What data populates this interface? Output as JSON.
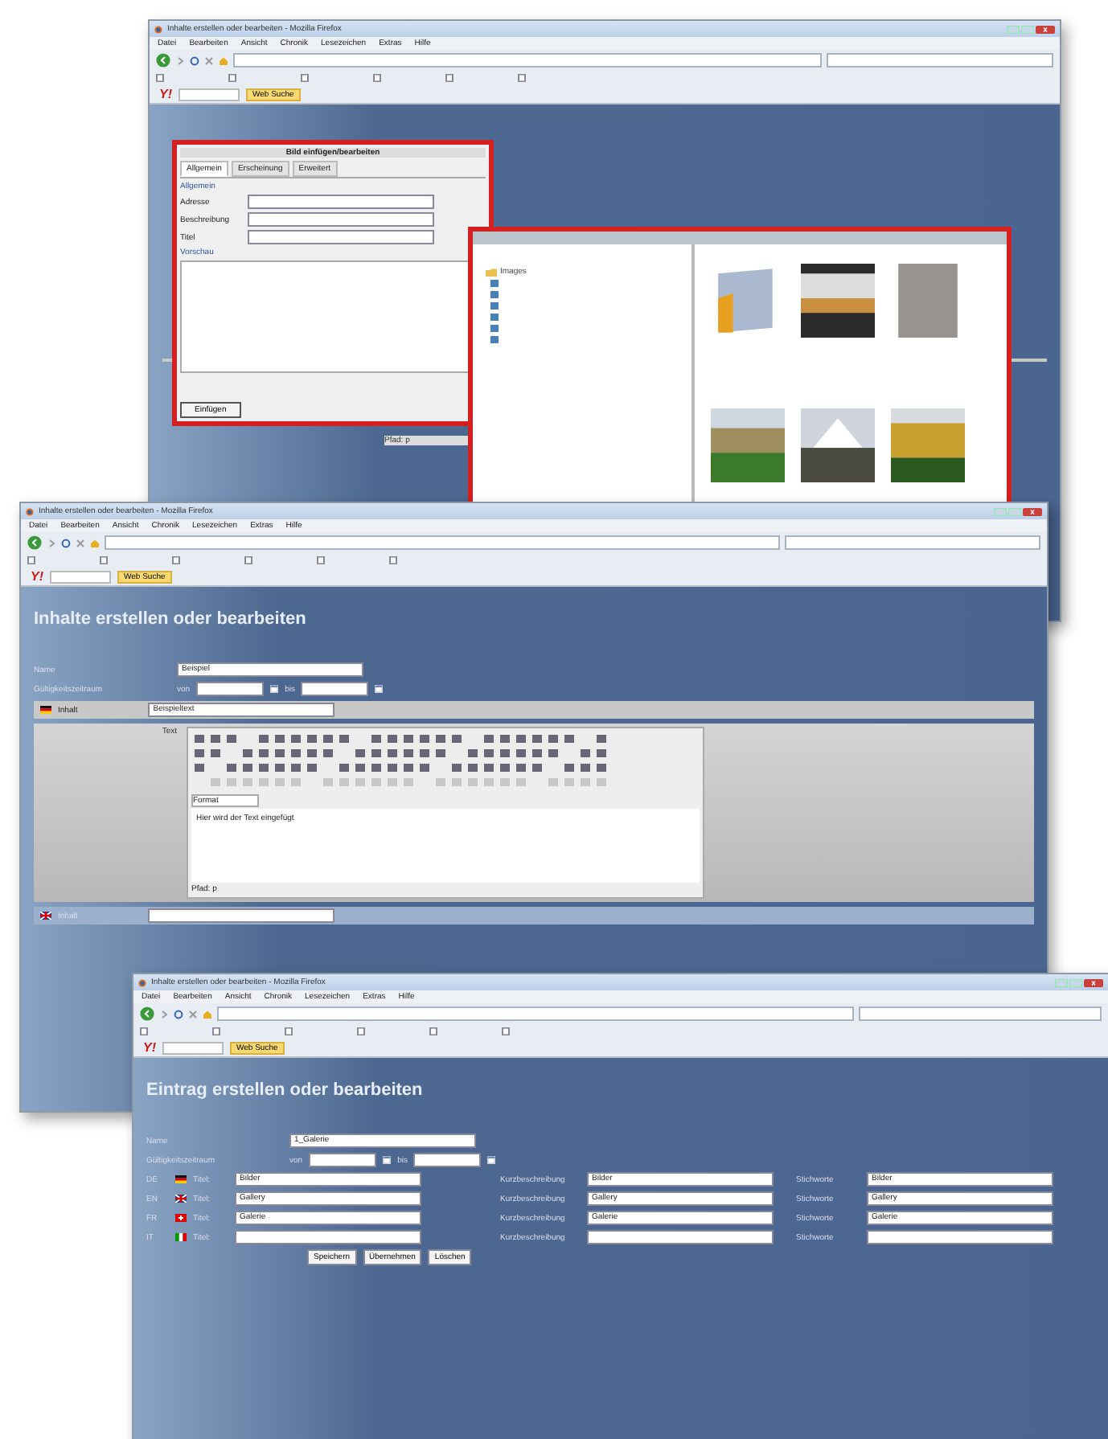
{
  "windows": [
    {
      "title": "Inhalte erstellen oder bearbeiten - Mozilla Firefox",
      "menu": [
        "Datei",
        "Bearbeiten",
        "Ansicht",
        "Chronik",
        "Lesezeichen",
        "Extras",
        "Hilfe"
      ],
      "toolbar": {
        "logo": "Y!",
        "search_button": "Web Suche"
      },
      "dialogs": [
        {
          "kind": "image_properties",
          "title": "Bild einfügen/bearbeiten",
          "tabs": [
            {
              "label": "Allgemein",
              "selected": true
            },
            {
              "label": "Erscheinung",
              "selected": false
            },
            {
              "label": "Erweitert",
              "selected": false
            }
          ],
          "legend": "Allgemein",
          "fields": [
            "Adresse",
            "Beschreibung",
            "Titel"
          ],
          "preview": "Vorschau",
          "buttons": [
            "Einfügen"
          ]
        },
        {
          "kind": "file_browser",
          "root": "Images"
        }
      ],
      "editor_status": "Pfad: p"
    },
    {
      "title": "Inhalte erstellen oder bearbeiten - Mozilla Firefox",
      "menu": [
        "Datei",
        "Bearbeiten",
        "Ansicht",
        "Chronik",
        "Lesezeichen",
        "Extras",
        "Hilfe"
      ],
      "toolbar": {
        "logo": "Y!",
        "search_button": "Web Suche"
      },
      "heading": "Inhalte erstellen oder bearbeiten",
      "form": {
        "name_label": "Name",
        "name": "Beispiel",
        "period_label": "Gültigkeitszeitraum",
        "from": "von",
        "to": "bis"
      },
      "content_row": {
        "kind": "de",
        "label": "Inhalt",
        "value": "Beispieltext",
        "text_label": "Text",
        "editor_text": "Hier wird der Text eingefügt",
        "format": "Format",
        "status": "Pfad: p"
      },
      "next_row": {
        "kind": "gb",
        "label": "Inhalt"
      }
    },
    {
      "title": "Inhalte erstellen oder bearbeiten - Mozilla Firefox",
      "menu": [
        "Datei",
        "Bearbeiten",
        "Ansicht",
        "Chronik",
        "Lesezeichen",
        "Extras",
        "Hilfe"
      ],
      "toolbar": {
        "logo": "Y!",
        "search_button": "Web Suche"
      },
      "heading": "Eintrag erstellen oder bearbeiten",
      "form": {
        "name_label": "Name",
        "name": "1_Galerie",
        "period_label": "Gültigkeitszeitraum",
        "from": "von",
        "to": "bis"
      },
      "languages": [
        {
          "code": "DE",
          "kind": "de",
          "title_label": "Titel:",
          "title": "Bilder",
          "desc_label": "Kurzbeschreibung",
          "desc": "Bilder",
          "keys_label": "Stichworte",
          "keys": "Bilder"
        },
        {
          "code": "EN",
          "kind": "gb",
          "title_label": "Titel:",
          "title": "Gallery",
          "desc_label": "Kurzbeschreibung",
          "desc": "Gallery",
          "keys_label": "Stichworte",
          "keys": "Gallery"
        },
        {
          "code": "FR",
          "kind": "ch",
          "title_label": "Titel:",
          "title": "Galerie",
          "desc_label": "Kurzbeschreibung",
          "desc": "Galerie",
          "keys_label": "Stichworte",
          "keys": "Galerie"
        },
        {
          "code": "IT",
          "kind": "it",
          "title_label": "Titel:",
          "desc_label": "Kurzbeschreibung",
          "keys_label": "Stichworte"
        }
      ],
      "buttons": [
        "Speichern",
        "Übernehmen",
        "Löschen"
      ]
    }
  ]
}
